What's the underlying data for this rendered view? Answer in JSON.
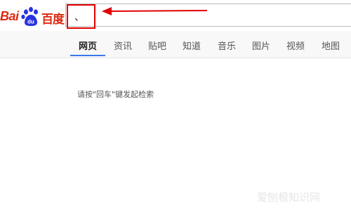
{
  "logo": {
    "latin": "Bai",
    "paw_glyph": "du",
    "chinese": "百度"
  },
  "search": {
    "query": "、"
  },
  "annotation": {
    "box_color": "#e10000",
    "arrow_color": "#e10000"
  },
  "tabs": [
    {
      "label": "网页",
      "active": true
    },
    {
      "label": "资讯"
    },
    {
      "label": "贴吧"
    },
    {
      "label": "知道"
    },
    {
      "label": "音乐"
    },
    {
      "label": "图片"
    },
    {
      "label": "视频"
    },
    {
      "label": "地图"
    }
  ],
  "hint": "请按\"回车\"键发起检索",
  "watermark": "爱刨根知识网",
  "colors": {
    "brand_red": "#de2910",
    "brand_blue": "#2932e1",
    "active_tab": "#3a78ec"
  }
}
